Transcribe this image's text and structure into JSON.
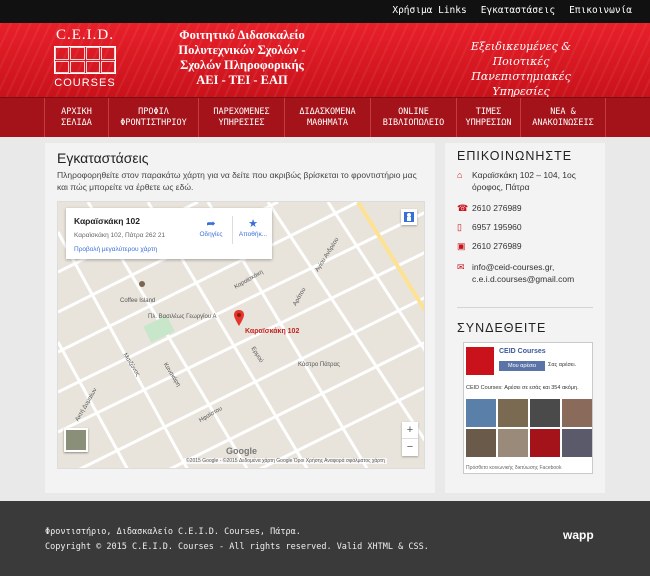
{
  "topbar": {
    "links": [
      "Χρήσιμα Links",
      "Εγκαταστάσεις",
      "Επικοινωνία"
    ]
  },
  "header": {
    "logo_top": "C.E.I.D.",
    "logo_bottom": "COURSES",
    "tagline": [
      "Φοιτητικό Διδασκαλείο",
      "Πολυτεχνικών Σχολών -",
      "Σχολών Πληροφορικής",
      "ΑΕΙ - ΤΕΙ - ΕΑΠ"
    ],
    "slogan": [
      "Εξειδικευμένες & Ποιοτικές",
      "Πανεπιστημιακές Υπηρεσίες"
    ]
  },
  "nav": [
    {
      "line1": "ΑΡΧΙΚΗ",
      "line2": "ΣΕΛΙΔΑ"
    },
    {
      "line1": "ΠΡΟΦΙΛ",
      "line2": "ΦΡΟΝΤΙΣΤΗΡΙΟΥ"
    },
    {
      "line1": "ΠΑΡΕΧΟΜΕΝΕΣ",
      "line2": "ΥΠΗΡΕΣΙΕΣ"
    },
    {
      "line1": "ΔΙΔΑΣΚΟΜΕΝΑ",
      "line2": "ΜΑΘΗΜΑΤΑ"
    },
    {
      "line1": "ONLINE",
      "line2": "ΒΙΒΛΙΟΠΩΛΕΙΟ"
    },
    {
      "line1": "ΤΙΜΕΣ",
      "line2": "ΥΠΗΡΕΣΙΩΝ"
    },
    {
      "line1": "ΝΕΑ &",
      "line2": "ΑΝΑΚΟΙΝΩΣΕΙΣ"
    }
  ],
  "main": {
    "title": "Εγκαταστάσεις",
    "intro": "Πληροφορηθείτε στον παρακάτω χάρτη για να δείτε που ακριβώς βρίσκεται το φροντιστήριο μας και πώς μπορείτε να έρθετε ως εδώ.",
    "map": {
      "card_title": "Καραϊσκάκη 102",
      "card_address": "Καραϊσκάκη 102, Πάτρα 262 21",
      "card_link": "Προβολή μεγαλύτερου χάρτη",
      "directions": "Οδηγίες",
      "save": "Αποθήκ...",
      "pin_label": "Καραϊσκάκη 102",
      "footer_text": "©2015 Google - ©2015 Δεδομένα χάρτη Google   Όροι Χρήσης   Αναφορά σφάλματος χάρτη",
      "google": "Google",
      "street_labels": [
        "Αγίου Ανδρέου",
        "Ακτή Δυμαίων",
        "Coffee Island",
        "Πλ. Βασιλέως Γεωργίου Α",
        "Καραϊσκάκη",
        "Αράτου",
        "Κάστρο Πάτρας",
        "Κανακάρη",
        "Μαιζώνος",
        "Ερμού",
        "Ηφαίστου"
      ]
    }
  },
  "sidebar": {
    "contact_title": "ΕΠΙΚΟΙΝΩΝΗΣΤΕ",
    "address": "Καραϊσκάκη 102 – 104, 1ος όροφος, Πάτρα",
    "phone1": "2610 276989",
    "mobile": "6957 195960",
    "fax": "2610 276989",
    "email": "info@ceid-courses.gr, c.e.i.d.courses@gmail.com",
    "connect_title": "ΣΥΝΔΕΘΕΙΤΕ",
    "fb": {
      "page_name": "CEID Courses",
      "like_label": "Μου αρέσει",
      "likes_text": "Σας αρέσει.",
      "count_text": "CEID Courses: Αρέσει σε εσάς και 354 ακόμη.",
      "plugin_text": "Πρόσθετο κοινωνικής δικτύωσης Facebook"
    }
  },
  "footer": {
    "line1": "Φροντιστήριο, Διδασκαλείο C.E.I.D. Courses, Πάτρα.",
    "line2": "Copyright © 2015 C.E.I.D. Courses - All rights reserved. Valid XHTML & CSS.",
    "brand": "wapp"
  }
}
